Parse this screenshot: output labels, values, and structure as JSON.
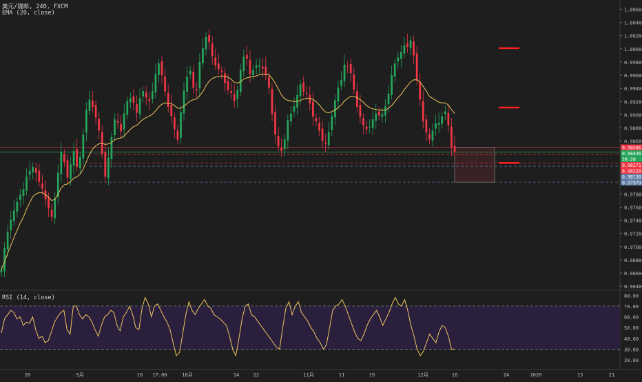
{
  "header": {
    "symbol_line": "美元/瑞郎, 240, FXCM",
    "ema_line": "EMA (20, close)",
    "rsi_line": "RSI (14, close)"
  },
  "chart_data": [
    {
      "type": "candlestick",
      "title": "美元/瑞郎, 240, FXCM",
      "indicator": "EMA (20, close)",
      "ylim": [
        0.9635,
        1.0074
      ],
      "y_ticks": [
        "1.00600",
        "1.00400",
        "1.00200",
        "1.00000",
        "0.99800",
        "0.99600",
        "0.99400",
        "0.99200",
        "0.99000",
        "0.98800",
        "0.98600",
        "0.98400",
        "0.98200",
        "0.98000",
        "0.97800",
        "0.97600",
        "0.97400",
        "0.97200",
        "0.97000",
        "0.96800",
        "0.96600",
        "0.96400"
      ],
      "x_ticks": [
        "20",
        "9月",
        "16",
        "17:00",
        "10月",
        "14",
        "22",
        "11月",
        "11",
        "19",
        "12月",
        "16",
        "24",
        "2020",
        "13",
        "21"
      ],
      "price_tags": [
        {
          "label": "0.98506",
          "value": 0.98506,
          "color": "#f23645"
        },
        {
          "label": "0.98436",
          "value": 0.98436,
          "color": "#26a65b"
        },
        {
          "label": "28:20",
          "value": 0.98359,
          "color": "#26a65b"
        },
        {
          "label": "0.98271",
          "value": 0.98271,
          "color": "#f23645"
        },
        {
          "label": "0.98220",
          "value": 0.9822,
          "color": "#f23645"
        },
        {
          "label": "0.98130",
          "value": 0.9813,
          "color": "#5f7da6"
        },
        {
          "label": "0.97979",
          "value": 0.97979,
          "color": "#5f7da6"
        }
      ],
      "candles_close": [
        0.9665,
        0.9698,
        0.9722,
        0.9741,
        0.9755,
        0.9768,
        0.9779,
        0.9787,
        0.9806,
        0.9815,
        0.9821,
        0.9812,
        0.9798,
        0.9788,
        0.9772,
        0.9758,
        0.9745,
        0.9772,
        0.9812,
        0.9843,
        0.9828,
        0.9805,
        0.9825,
        0.9845,
        0.9821,
        0.9836,
        0.987,
        0.9908,
        0.9923,
        0.9912,
        0.9896,
        0.9876,
        0.9841,
        0.9806,
        0.9835,
        0.9866,
        0.9893,
        0.9888,
        0.9875,
        0.9902,
        0.9921,
        0.9925,
        0.9918,
        0.9903,
        0.9925,
        0.9936,
        0.9926,
        0.9921,
        0.9936,
        0.9962,
        0.9978,
        0.996,
        0.9935,
        0.9912,
        0.9898,
        0.9878,
        0.9862,
        0.9904,
        0.9937,
        0.9958,
        0.9967,
        0.9941,
        0.9937,
        0.998,
        1.0001,
        1.0018,
        1.001,
        0.9989,
        0.9975,
        0.9969,
        0.9965,
        0.9948,
        0.9938,
        0.9933,
        0.9921,
        0.9937,
        0.9968,
        0.9988,
        0.9985,
        0.9962,
        0.9968,
        0.9975,
        0.9975,
        0.997,
        0.996,
        0.9941,
        0.9901,
        0.987,
        0.9852,
        0.9845,
        0.9863,
        0.9892,
        0.9902,
        0.9913,
        0.993,
        0.9946,
        0.9935,
        0.9932,
        0.9917,
        0.9897,
        0.989,
        0.9876,
        0.986,
        0.9856,
        0.9874,
        0.9898,
        0.9922,
        0.9941,
        0.9953,
        0.9976,
        0.9974,
        0.9963,
        0.9938,
        0.9912,
        0.9897,
        0.9884,
        0.9878,
        0.9882,
        0.9893,
        0.9902,
        0.9899,
        0.9901,
        0.9913,
        0.9932,
        0.996,
        0.9978,
        0.9987,
        0.9995,
        1.0005,
        1.0003,
        1.0013,
        0.999,
        0.9952,
        0.9923,
        0.989,
        0.9873,
        0.9863,
        0.9876,
        0.9887,
        0.9888,
        0.9898,
        0.9905,
        0.9884,
        0.985,
        0.9843
      ],
      "ema_values": [
        0.9665,
        0.9677,
        0.969,
        0.9702,
        0.9714,
        0.9725,
        0.9736,
        0.9745,
        0.9757,
        0.9767,
        0.9776,
        0.978,
        0.9782,
        0.9782,
        0.9779,
        0.9775,
        0.977,
        0.9772,
        0.978,
        0.9789,
        0.9794,
        0.9795,
        0.9799,
        0.9804,
        0.9806,
        0.981,
        0.9818,
        0.9829,
        0.984,
        0.9848,
        0.9853,
        0.9856,
        0.9857,
        0.9855,
        0.9856,
        0.9858,
        0.9862,
        0.9864,
        0.9865,
        0.9868,
        0.9873,
        0.9878,
        0.9882,
        0.9884,
        0.9889,
        0.9893,
        0.9896,
        0.9898,
        0.9901,
        0.9906,
        0.9912,
        0.9916,
        0.9918,
        0.9917,
        0.9917,
        0.9914,
        0.991,
        0.991,
        0.9913,
        0.9917,
        0.9921,
        0.9923,
        0.9924,
        0.9929,
        0.9935,
        0.9944,
        0.9951,
        0.9955,
        0.9957,
        0.9958,
        0.9959,
        0.9958,
        0.9957,
        0.9954,
        0.9949,
        0.9948,
        0.995,
        0.9954,
        0.9956,
        0.9957,
        0.9958,
        0.9959,
        0.9961,
        0.9962,
        0.9961,
        0.9961,
        0.9955,
        0.9948,
        0.9939,
        0.993,
        0.9924,
        0.9922,
        0.9921,
        0.992,
        0.992,
        0.9922,
        0.9924,
        0.9925,
        0.9925,
        0.9923,
        0.992,
        0.9915,
        0.9909,
        0.9904,
        0.9903,
        0.9905,
        0.9907,
        0.9911,
        0.9915,
        0.9921,
        0.9925,
        0.9928,
        0.9928,
        0.9926,
        0.9923,
        0.9919,
        0.9914,
        0.9911,
        0.9909,
        0.9908,
        0.9907,
        0.9907,
        0.9907,
        0.991,
        0.9914,
        0.992,
        0.9926,
        0.9931,
        0.9938,
        0.9944,
        0.995,
        0.9953,
        0.9953,
        0.995,
        0.9943,
        0.9936,
        0.9928,
        0.9925,
        0.9922,
        0.9919,
        0.9918,
        0.9918,
        0.9915,
        0.9908,
        0.9902
      ],
      "horizontal_lines": [
        {
          "value": 0.98506,
          "style": "solid",
          "color": "#f23645"
        },
        {
          "value": 0.98436,
          "style": "solid",
          "color": "#26a65b"
        },
        {
          "value": 0.98403,
          "style": "dashed",
          "color": "#f23645"
        },
        {
          "value": 0.98271,
          "style": "dashed",
          "color": "#f23645"
        },
        {
          "value": 0.9822,
          "style": "dashed",
          "color": "#5f7da6"
        },
        {
          "value": 0.97979,
          "style": "dashed",
          "color": "#5f7da6"
        }
      ],
      "target_marks": [
        1.0001,
        0.9911,
        0.9827
      ],
      "box_zone": {
        "from": 0.98506,
        "to": 0.97979,
        "color": "#f23645"
      }
    },
    {
      "type": "line",
      "title": "RSI (14, close)",
      "ylim": [
        20,
        84
      ],
      "y_ticks": [
        "80.00",
        "70.00",
        "60.00",
        "50.00",
        "40.00",
        "30.00",
        "20.00"
      ],
      "band": [
        30,
        70
      ],
      "values": [
        45,
        58,
        62,
        66,
        64,
        58,
        60,
        52,
        55,
        54,
        60,
        48,
        40,
        42,
        36,
        38,
        46,
        55,
        60,
        64,
        66,
        48,
        44,
        70,
        70,
        62,
        58,
        62,
        60,
        55,
        48,
        42,
        52,
        60,
        62,
        66,
        64,
        52,
        47,
        60,
        64,
        70,
        62,
        50,
        48,
        68,
        78,
        72,
        60,
        70,
        72,
        66,
        60,
        55,
        48,
        35,
        24,
        27,
        44,
        62,
        74,
        66,
        62,
        68,
        72,
        76,
        70,
        68,
        62,
        60,
        58,
        55,
        52,
        42,
        30,
        24,
        40,
        58,
        70,
        72,
        62,
        60,
        56,
        52,
        48,
        44,
        40,
        36,
        32,
        30,
        50,
        68,
        74,
        62,
        70,
        74,
        64,
        60,
        56,
        50,
        46,
        40,
        36,
        30,
        34,
        50,
        66,
        70,
        72,
        76,
        70,
        62,
        54,
        46,
        40,
        38,
        44,
        52,
        58,
        62,
        66,
        60,
        52,
        58,
        64,
        72,
        78,
        72,
        70,
        76,
        66,
        52,
        42,
        30,
        24,
        28,
        36,
        44,
        40,
        36,
        46,
        52,
        50,
        42,
        30,
        30
      ]
    }
  ]
}
